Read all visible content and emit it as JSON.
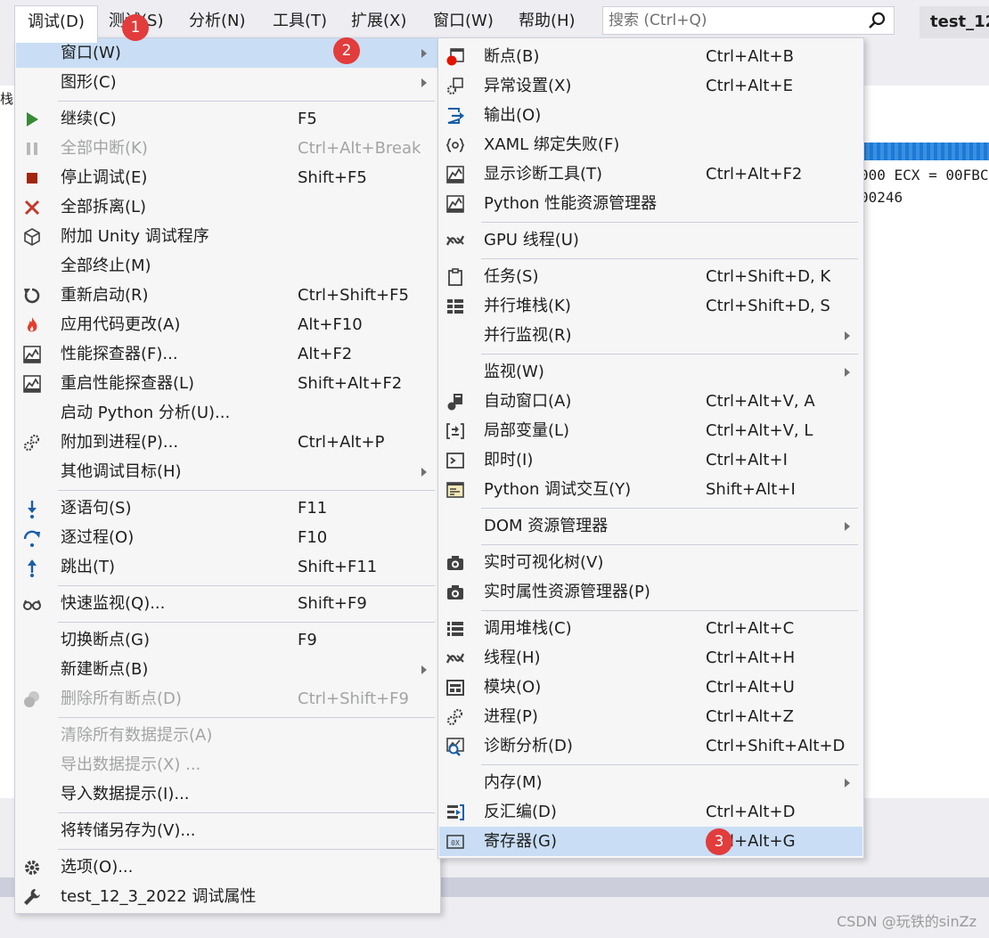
{
  "menubar": {
    "items": [
      "调试(D)",
      "测试(S)",
      "分析(N)",
      "工具(T)",
      "扩展(X)",
      "窗口(W)",
      "帮助(H)"
    ],
    "search_placeholder": "搜索 (Ctrl+Q)",
    "title_tab": "test_12_"
  },
  "background": {
    "register_lines": [
      "000 ECX = 00FBC",
      "00246"
    ],
    "left_edge_text": "栈"
  },
  "debug_menu": {
    "items": [
      {
        "label": "窗口(W)",
        "shortcut": "",
        "icon": "none"
      },
      {
        "label": "图形(C)",
        "shortcut": "",
        "icon": "none"
      },
      {
        "label": "继续(C)",
        "shortcut": "F5",
        "icon": "play-icon"
      },
      {
        "label": "全部中断(K)",
        "shortcut": "Ctrl+Alt+Break",
        "icon": "pause-icon"
      },
      {
        "label": "停止调试(E)",
        "shortcut": "Shift+F5",
        "icon": "stop-icon"
      },
      {
        "label": "全部拆离(L)",
        "shortcut": "",
        "icon": "x-icon"
      },
      {
        "label": "附加 Unity 调试程序",
        "shortcut": "",
        "icon": "cube-icon"
      },
      {
        "label": "全部终止(M)",
        "shortcut": "",
        "icon": "none"
      },
      {
        "label": "重新启动(R)",
        "shortcut": "Ctrl+Shift+F5",
        "icon": "restart-icon"
      },
      {
        "label": "应用代码更改(A)",
        "shortcut": "Alt+F10",
        "icon": "flame-icon"
      },
      {
        "label": "性能探查器(F)...",
        "shortcut": "Alt+F2",
        "icon": "chart-icon"
      },
      {
        "label": "重启性能探查器(L)",
        "shortcut": "Shift+Alt+F2",
        "icon": "chart-icon"
      },
      {
        "label": "启动 Python 分析(U)...",
        "shortcut": "",
        "icon": "none"
      },
      {
        "label": "附加到进程(P)...",
        "shortcut": "Ctrl+Alt+P",
        "icon": "gears-icon"
      },
      {
        "label": "其他调试目标(H)",
        "shortcut": "",
        "icon": "none"
      },
      {
        "label": "逐语句(S)",
        "shortcut": "F11",
        "icon": "step-into-icon"
      },
      {
        "label": "逐过程(O)",
        "shortcut": "F10",
        "icon": "step-over-icon"
      },
      {
        "label": "跳出(T)",
        "shortcut": "Shift+F11",
        "icon": "step-out-icon"
      },
      {
        "label": "快速监视(Q)...",
        "shortcut": "Shift+F9",
        "icon": "glasses-icon"
      },
      {
        "label": "切换断点(G)",
        "shortcut": "F9",
        "icon": "none"
      },
      {
        "label": "新建断点(B)",
        "shortcut": "",
        "icon": "none"
      },
      {
        "label": "删除所有断点(D)",
        "shortcut": "Ctrl+Shift+F9",
        "icon": "delete-breakpoints-icon"
      },
      {
        "label": "清除所有数据提示(A)",
        "shortcut": "",
        "icon": "none"
      },
      {
        "label": "导出数据提示(X) ...",
        "shortcut": "",
        "icon": "none"
      },
      {
        "label": "导入数据提示(I)...",
        "shortcut": "",
        "icon": "none"
      },
      {
        "label": "将转储另存为(V)...",
        "shortcut": "",
        "icon": "none"
      },
      {
        "label": "选项(O)...",
        "shortcut": "",
        "icon": "gear-icon"
      },
      {
        "label": "test_12_3_2022 调试属性",
        "shortcut": "",
        "icon": "wrench-icon"
      }
    ]
  },
  "window_menu": {
    "items": [
      {
        "label": "断点(B)",
        "shortcut": "Ctrl+Alt+B",
        "icon": "breakpoint-window-icon"
      },
      {
        "label": "异常设置(X)",
        "shortcut": "Ctrl+Alt+E",
        "icon": "exception-icon"
      },
      {
        "label": "输出(O)",
        "shortcut": "",
        "icon": "output-icon"
      },
      {
        "label": "XAML 绑定失败(F)",
        "shortcut": "",
        "icon": "xaml-icon"
      },
      {
        "label": "显示诊断工具(T)",
        "shortcut": "Ctrl+Alt+F2",
        "icon": "diagnostic-icon"
      },
      {
        "label": "Python 性能资源管理器",
        "shortcut": "",
        "icon": "diagnostic-icon"
      },
      {
        "label": "GPU 线程(U)",
        "shortcut": "",
        "icon": "threads-icon"
      },
      {
        "label": "任务(S)",
        "shortcut": "Ctrl+Shift+D, K",
        "icon": "clipboard-icon"
      },
      {
        "label": "并行堆栈(K)",
        "shortcut": "Ctrl+Shift+D, S",
        "icon": "parallel-stacks-icon"
      },
      {
        "label": "并行监视(R)",
        "shortcut": "",
        "icon": "none"
      },
      {
        "label": "监视(W)",
        "shortcut": "",
        "icon": "none"
      },
      {
        "label": "自动窗口(A)",
        "shortcut": "Ctrl+Alt+V, A",
        "icon": "autos-icon"
      },
      {
        "label": "局部变量(L)",
        "shortcut": "Ctrl+Alt+V, L",
        "icon": "locals-icon"
      },
      {
        "label": "即时(I)",
        "shortcut": "Ctrl+Alt+I",
        "icon": "immediate-icon"
      },
      {
        "label": "Python 调试交互(Y)",
        "shortcut": "Shift+Alt+I",
        "icon": "python-interactive-icon"
      },
      {
        "label": "DOM 资源管理器",
        "shortcut": "",
        "icon": "none"
      },
      {
        "label": "实时可视化树(V)",
        "shortcut": "",
        "icon": "camera-icon"
      },
      {
        "label": "实时属性资源管理器(P)",
        "shortcut": "",
        "icon": "camera-icon"
      },
      {
        "label": "调用堆栈(C)",
        "shortcut": "Ctrl+Alt+C",
        "icon": "call-stack-icon"
      },
      {
        "label": "线程(H)",
        "shortcut": "Ctrl+Alt+H",
        "icon": "threads-icon"
      },
      {
        "label": "模块(O)",
        "shortcut": "Ctrl+Alt+U",
        "icon": "modules-icon"
      },
      {
        "label": "进程(P)",
        "shortcut": "Ctrl+Alt+Z",
        "icon": "gears-icon"
      },
      {
        "label": "诊断分析(D)",
        "shortcut": "Ctrl+Shift+Alt+D",
        "icon": "diagnostic-analysis-icon"
      },
      {
        "label": "内存(M)",
        "shortcut": "",
        "icon": "none"
      },
      {
        "label": "反汇编(D)",
        "shortcut": "Ctrl+Alt+D",
        "icon": "disassembly-icon"
      },
      {
        "label": "寄存器(G)",
        "shortcut": "Ctrl+Alt+G",
        "icon": "registers-icon"
      }
    ]
  },
  "badges": [
    "1",
    "2",
    "3"
  ],
  "watermark": "CSDN @玩铁的sinZz",
  "colors": {
    "highlight": "#c9def5",
    "badge": "#e23c3c",
    "accent": "#1c7ad6"
  }
}
